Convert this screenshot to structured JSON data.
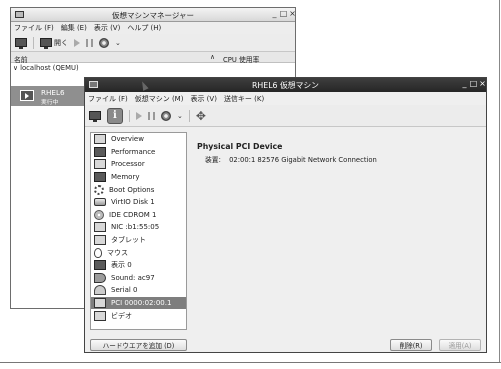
{
  "manager": {
    "title": "仮想マシンマネージャー",
    "menus": [
      "ファイル (F)",
      "編集 (E)",
      "表示 (V)",
      "ヘルプ (H)"
    ],
    "toolbar": {
      "open_label": "開く"
    },
    "columns": {
      "name": "名前",
      "sort_arrow": "∧",
      "cpu": "CPU 使用率"
    },
    "host": "∨ localhost (QEMU)",
    "vm": {
      "name": "RHEL6",
      "state": "実行中"
    }
  },
  "vm_window": {
    "title": "RHEL6 仮想マシン",
    "menus": [
      "ファイル (F)",
      "仮想マシン (M)",
      "表示 (V)",
      "送信キー (K)"
    ],
    "hardware_list": [
      {
        "label": "Overview",
        "icon": "overview-icon"
      },
      {
        "label": "Performance",
        "icon": "performance-icon"
      },
      {
        "label": "Processor",
        "icon": "processor-icon"
      },
      {
        "label": "Memory",
        "icon": "memory-icon"
      },
      {
        "label": "Boot Options",
        "icon": "gear-icon"
      },
      {
        "label": "VirtIO Disk 1",
        "icon": "disk-icon"
      },
      {
        "label": "IDE CDROM 1",
        "icon": "cdrom-icon"
      },
      {
        "label": "NIC :b1:55:05",
        "icon": "network-icon"
      },
      {
        "label": "タブレット",
        "icon": "tablet-icon"
      },
      {
        "label": "マウス",
        "icon": "mouse-icon"
      },
      {
        "label": "表示 0",
        "icon": "display-icon"
      },
      {
        "label": "Sound: ac97",
        "icon": "sound-icon"
      },
      {
        "label": "Serial 0",
        "icon": "serial-icon"
      },
      {
        "label": "PCI 0000:02:00.1",
        "icon": "pci-icon",
        "selected": true
      },
      {
        "label": "ビデオ",
        "icon": "video-icon"
      }
    ],
    "detail": {
      "title": "Physical PCI Device",
      "device_key": "装置:",
      "device_value": "02:00:1 82576 Gigabit Network Connection"
    },
    "buttons": {
      "add_hardware": "ハードウエアを追加 (D)",
      "remove": "削除(R)",
      "apply": "適用(A)"
    }
  }
}
